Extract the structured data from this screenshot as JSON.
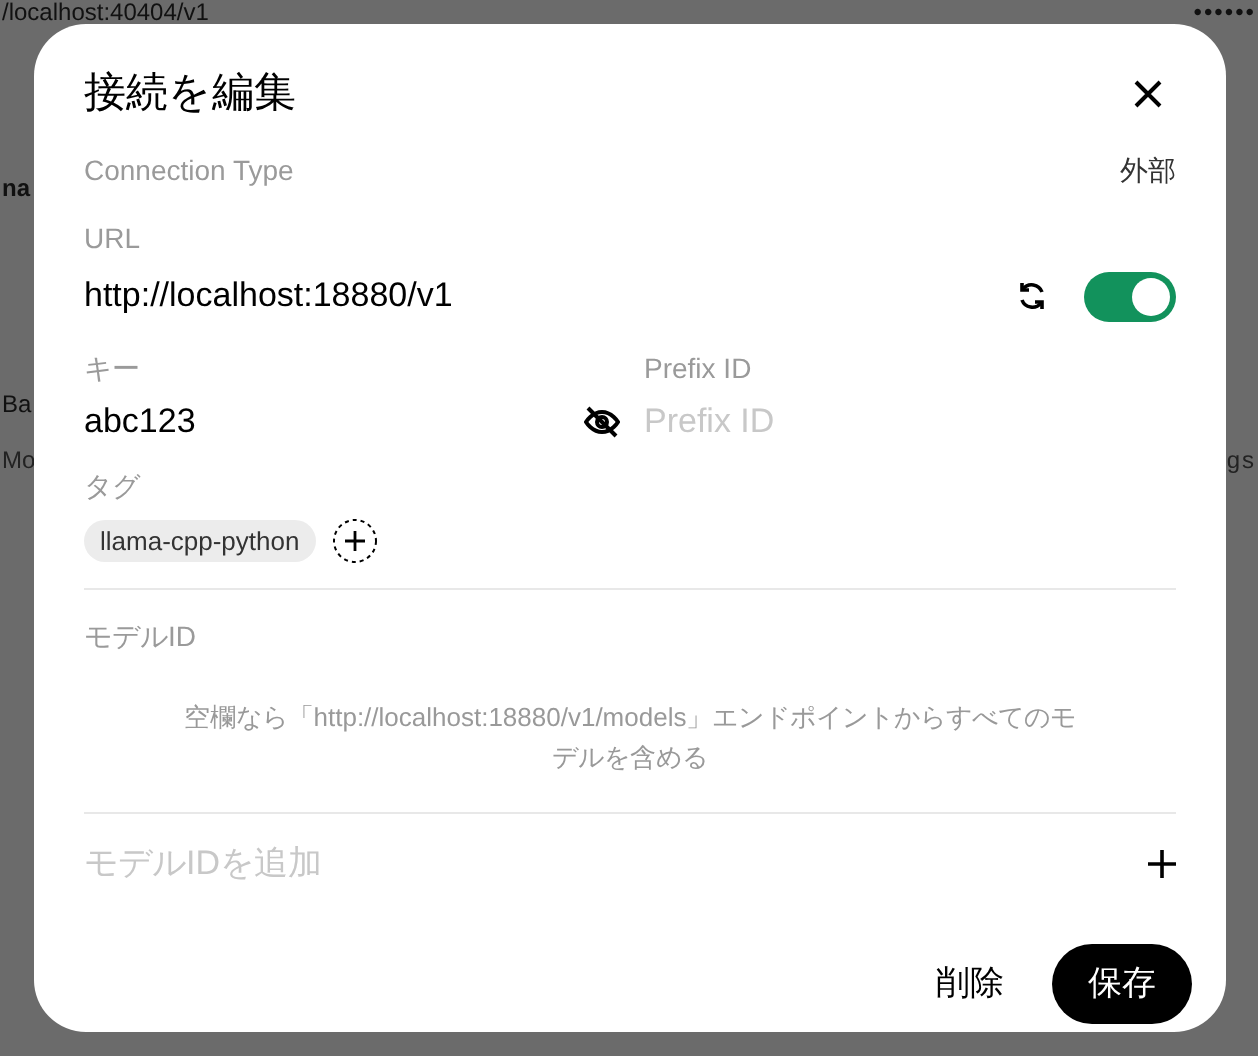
{
  "background": {
    "rows": [
      {
        "left": "/localhost:40404/v1",
        "right": "••••••"
      },
      {
        "left": "na",
        "right": ""
      },
      {
        "left": "Ba",
        "right": ""
      },
      {
        "left": "Mo",
        "right": "gs"
      }
    ]
  },
  "dialog": {
    "title": "接続を編集",
    "connection_type": {
      "label": "Connection Type",
      "value": "外部"
    },
    "url": {
      "label": "URL",
      "value": "http://localhost:18880/v1",
      "enabled": true
    },
    "key": {
      "label": "キー",
      "value": "abc123"
    },
    "prefix_id": {
      "label": "Prefix ID",
      "placeholder": "Prefix ID"
    },
    "tags": {
      "label": "タグ",
      "items": [
        "llama-cpp-python"
      ]
    },
    "model_ids": {
      "label": "モデルID",
      "help": "空欄なら「http://localhost:18880/v1/models」エンドポイントからすべてのモデルを含める",
      "add_placeholder": "モデルIDを追加"
    },
    "buttons": {
      "delete": "削除",
      "save": "保存"
    }
  }
}
